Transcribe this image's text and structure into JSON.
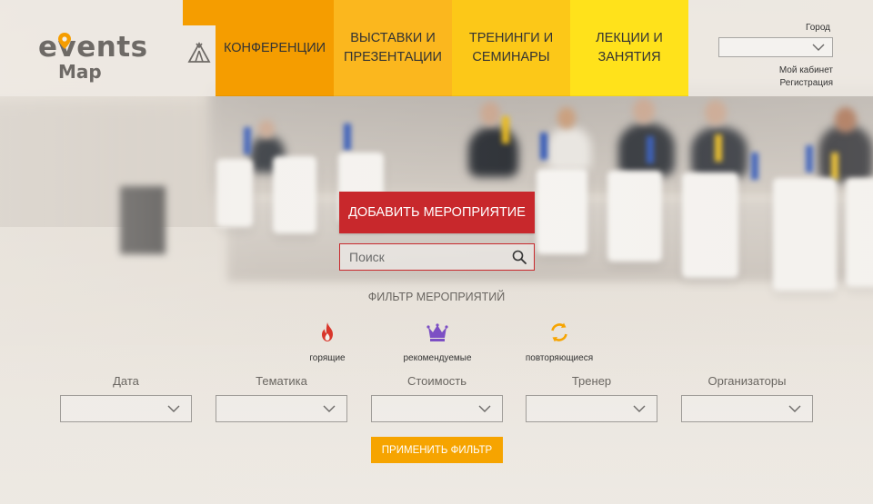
{
  "brand": {
    "logo_word_top": "events",
    "logo_word_bottom": "Map",
    "logo_color": "#6e6a66",
    "pin_color": "#f59d00"
  },
  "nav": {
    "items": [
      {
        "label": "КОНФЕРЕНЦИИ",
        "color": "#f59d00"
      },
      {
        "label": "ВЫСТАВКИ И\nПРЕЗЕНТАЦИИ",
        "color": "#fbb71e"
      },
      {
        "label": "ТРЕНИНГИ И\nСЕМИНАРЫ",
        "color": "#fcc818"
      },
      {
        "label": "ЛЕКЦИИ И\nЗАНЯТИЯ",
        "color": "#ffe21b"
      }
    ],
    "tent_icon": "tent-icon"
  },
  "header_right": {
    "city_label": "Город",
    "city_value": "",
    "account_link": "Мой кабинет",
    "register_link": "Регистрация"
  },
  "actions": {
    "add_event_label": "ДОБАВИТЬ МЕРОПРИЯТИЕ",
    "add_event_color": "#c8282c",
    "search_placeholder": "Поиск",
    "search_icon": "search-icon"
  },
  "filters": {
    "title": "ФИЛЬТР МЕРОПРИЯТИЙ",
    "quick": [
      {
        "label": "горящие",
        "icon": "flame-icon",
        "color": "#d9362b"
      },
      {
        "label": "рекомендуемые",
        "icon": "crown-icon",
        "color": "#7c4fc4"
      },
      {
        "label": "повторяющиеся",
        "icon": "repeat-icon",
        "color": "#f6a400"
      }
    ],
    "fields": [
      {
        "label": "Дата",
        "value": ""
      },
      {
        "label": "Тематика",
        "value": ""
      },
      {
        "label": "Стоимость",
        "value": ""
      },
      {
        "label": "Тренер",
        "value": ""
      },
      {
        "label": "Организаторы",
        "value": ""
      }
    ],
    "apply_label": "ПРИМЕНИТЬ ФИЛЬТР",
    "apply_color": "#f6a400"
  }
}
